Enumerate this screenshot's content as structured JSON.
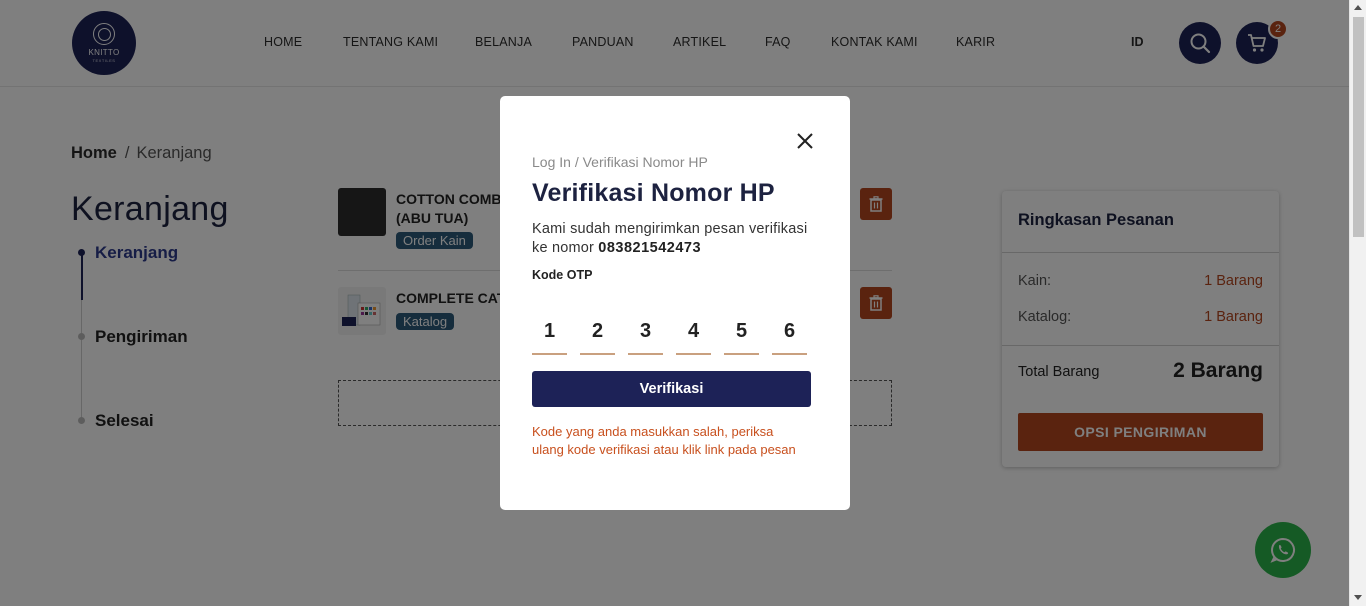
{
  "header": {
    "logo": {
      "brand": "KNITTO",
      "sub": "TEXTILES"
    },
    "nav": [
      "HOME",
      "TENTANG KAMI",
      "BELANJA",
      "PANDUAN",
      "ARTIKEL",
      "FAQ",
      "KONTAK KAMI",
      "KARIR"
    ],
    "lang": "ID",
    "cart_count": "2",
    "icons": {
      "search": "search-icon",
      "cart": "cart-icon"
    }
  },
  "breadcrumb": {
    "home": "Home",
    "separator": "/",
    "current": "Keranjang"
  },
  "page_title": "Keranjang",
  "steps": [
    {
      "label": "Keranjang",
      "active": true
    },
    {
      "label": "Pengiriman",
      "active": false
    },
    {
      "label": "Selesai",
      "active": false
    }
  ],
  "cart_items": [
    {
      "name_line1": "COTTON COMB",
      "name_line2": "(ABU TUA)",
      "tag": "Order Kain"
    },
    {
      "name_line1": "COMPLETE CAT",
      "tag": "Katalog"
    }
  ],
  "summary": {
    "title": "Ringkasan Pesanan",
    "rows": [
      {
        "label": "Kain:",
        "value": "1 Barang"
      },
      {
        "label": "Katalog:",
        "value": "1 Barang"
      }
    ],
    "total_label": "Total Barang",
    "total_value": "2 Barang",
    "button": "OPSI PENGIRIMAN"
  },
  "modal": {
    "breadcrumb": "Log In / Verifikasi Nomor HP",
    "title": "Verifikasi Nomor HP",
    "description": "Kami sudah mengirimkan pesan verifikasi ke nomor",
    "phone": "083821542473",
    "otp_label": "Kode OTP",
    "otp_digits": [
      "1",
      "2",
      "3",
      "4",
      "5",
      "6"
    ],
    "verify_button": "Verifikasi",
    "error_line1": "Kode yang anda masukkan salah, periksa",
    "error_line2": "ulang kode verifikasi atau klik link pada pesan"
  },
  "colors": {
    "navy": "#1d2257",
    "accent": "#b5461f",
    "tag": "#2c5a7a",
    "whatsapp": "#2bb54a"
  }
}
